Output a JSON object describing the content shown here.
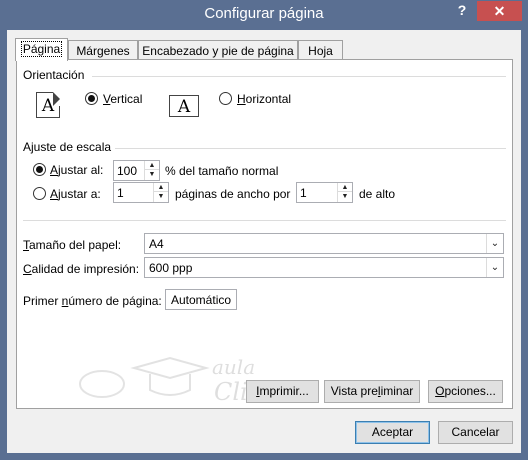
{
  "window": {
    "title": "Configurar página",
    "help": "?",
    "close": "✕"
  },
  "tabs": [
    {
      "label": "Página",
      "active": true
    },
    {
      "label": "Márgenes",
      "active": false
    },
    {
      "label": "Encabezado y pie de página",
      "active": false
    },
    {
      "label": "Hoja",
      "active": false
    }
  ],
  "orientation": {
    "heading": "Orientación",
    "portrait_icon": "A",
    "landscape_icon": "A",
    "portrait": {
      "label_first": "V",
      "label_rest": "ertical",
      "checked": true
    },
    "landscape": {
      "label_first": "H",
      "label_rest": "orizontal",
      "checked": false
    }
  },
  "scaling": {
    "heading": "Ajuste de escala",
    "adjust_to": {
      "label_first": "A",
      "label_rest": "justar al:",
      "value": "100",
      "suffix": "% del tamaño normal",
      "checked": true
    },
    "fit_to": {
      "label_first": "A",
      "label_rest": "justar a:",
      "pages_wide": "1",
      "mid_text": "páginas de ancho por",
      "pages_tall": "1",
      "suffix": "de alto",
      "checked": false
    }
  },
  "paper_size": {
    "label_first": "T",
    "label_rest": "amaño del papel:",
    "value": "A4"
  },
  "print_quality": {
    "label_first": "C",
    "label_rest": "alidad de impresión:",
    "value": "600 ppp"
  },
  "first_page_number": {
    "label_pre": "Primer ",
    "label_first": "n",
    "label_rest": "úmero de página:",
    "value": "Automático"
  },
  "buttons": {
    "print": {
      "label_first": "I",
      "label_rest": "mprimir..."
    },
    "preview": {
      "label_pre": "Vista pre",
      "label_first": "l",
      "label_rest": "iminar"
    },
    "options": {
      "label_first": "O",
      "label_rest": "pciones..."
    },
    "accept": "Aceptar",
    "cancel": "Cancelar"
  },
  "watermark": {
    "line1": "aula",
    "line2": "Clic"
  },
  "colors": {
    "titlebar": "#5a6f92",
    "close": "#c75050",
    "accent": "#3c7fb1"
  },
  "icons": {
    "spin_up": "▲",
    "spin_down": "▼",
    "chevron": "⌄"
  }
}
